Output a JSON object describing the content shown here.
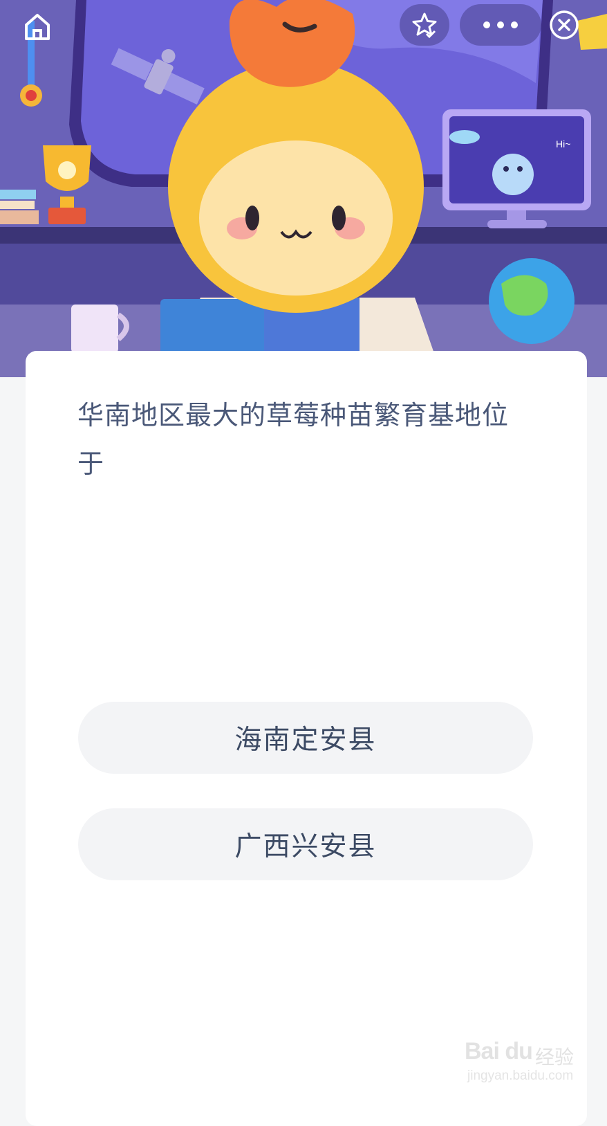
{
  "question": {
    "text": "华南地区最大的草莓种苗繁育基地位于"
  },
  "options": [
    {
      "label": "海南定安县"
    },
    {
      "label": "广西兴安县"
    }
  ],
  "hero": {
    "monitor_bubble": "Hi~"
  },
  "topbar": {
    "home_icon": "home-icon",
    "favorite_icon": "star-check-icon",
    "more_icon": "more-dots-icon",
    "close_icon": "close-circle-icon"
  },
  "watermark": {
    "logo": "Bai du",
    "cn": "经验",
    "url": "jingyan.baidu.com"
  },
  "colors": {
    "hero_bg": "#5e55a8",
    "card": "#ffffff",
    "page_bg": "#f5f6f7",
    "question_text": "#4a5878",
    "option_bg": "#f3f4f6"
  }
}
